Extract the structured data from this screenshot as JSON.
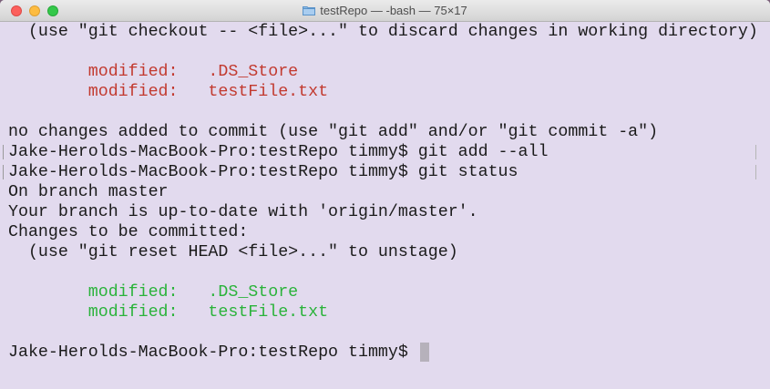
{
  "window": {
    "title": "testRepo — -bash — 75×17"
  },
  "terminal": {
    "line1": "  (use \"git checkout -- <file>...\" to discard changes in working directory)",
    "line2": "",
    "line3_label": "        modified:   ",
    "line3_file": ".DS_Store",
    "line4_label": "        modified:   ",
    "line4_file": "testFile.txt",
    "line5": "",
    "line6": "no changes added to commit (use \"git add\" and/or \"git commit -a\")",
    "line7": "Jake-Herolds-MacBook-Pro:testRepo timmy$ git add --all",
    "line8": "Jake-Herolds-MacBook-Pro:testRepo timmy$ git status",
    "line9": "On branch master",
    "line10": "Your branch is up-to-date with 'origin/master'.",
    "line11": "Changes to be committed:",
    "line12": "  (use \"git reset HEAD <file>...\" to unstage)",
    "line13": "",
    "line14_label": "        modified:   ",
    "line14_file": ".DS_Store",
    "line15_label": "        modified:   ",
    "line15_file": "testFile.txt",
    "line16": "",
    "prompt": "Jake-Herolds-MacBook-Pro:testRepo timmy$ "
  },
  "icons": {
    "folder": "folder-icon"
  },
  "colors": {
    "background": "#e2daee",
    "unstaged": "#c23a2f",
    "staged": "#2ab33a"
  }
}
